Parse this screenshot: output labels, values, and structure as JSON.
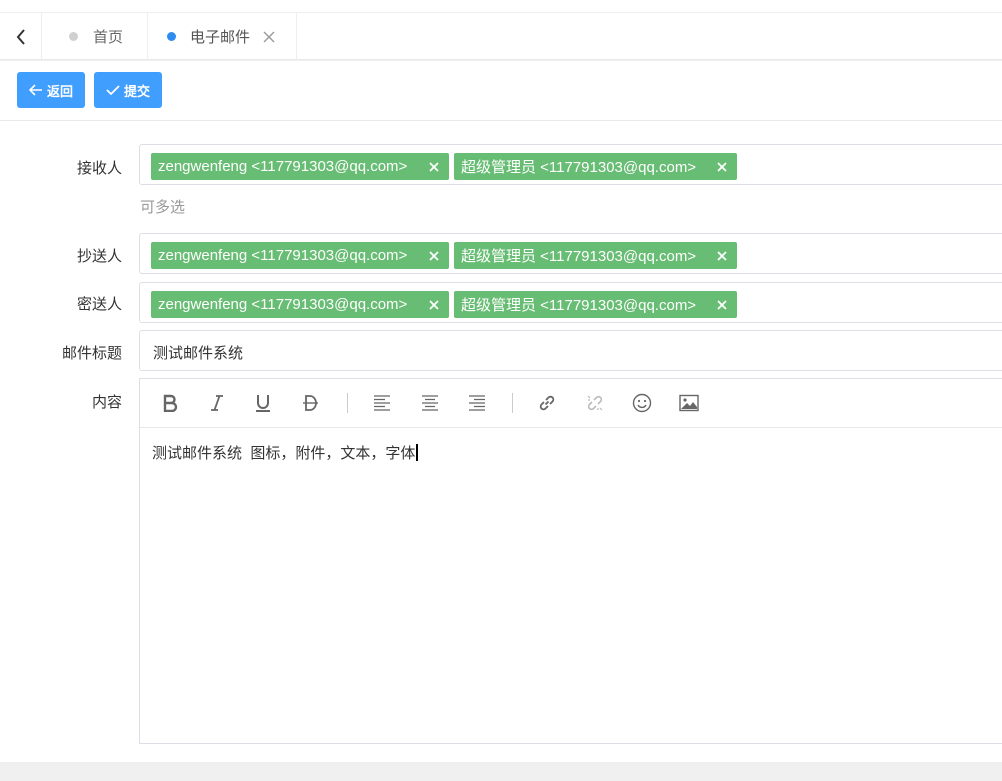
{
  "tabs": [
    {
      "label": "首页",
      "active": false
    },
    {
      "label": "电子邮件",
      "active": true
    }
  ],
  "toolbar": {
    "back_label": "返回",
    "submit_label": "提交"
  },
  "form": {
    "to": {
      "label": "接收人",
      "hint": "可多选",
      "tags": [
        "zengwenfeng <117791303@qq.com>",
        "超级管理员 <117791303@qq.com>"
      ]
    },
    "cc": {
      "label": "抄送人",
      "tags": [
        "zengwenfeng <117791303@qq.com>",
        "超级管理员 <117791303@qq.com>"
      ]
    },
    "bcc": {
      "label": "密送人",
      "tags": [
        "zengwenfeng <117791303@qq.com>",
        "超级管理员 <117791303@qq.com>"
      ]
    },
    "subject": {
      "label": "邮件标题",
      "value": "测试邮件系统"
    },
    "content": {
      "label": "内容",
      "value": "测试邮件系统  图标，附件，文本，字体"
    }
  },
  "editor_toolbar": [
    "bold-icon",
    "italic-icon",
    "underline-icon",
    "strikethrough-icon",
    "align-left-icon",
    "align-center-icon",
    "align-right-icon",
    "link-icon",
    "unlink-icon",
    "emoji-icon",
    "image-icon"
  ],
  "colors": {
    "primary": "#409eff",
    "tag": "#67bd73",
    "active_dot": "#2d8cf0"
  }
}
